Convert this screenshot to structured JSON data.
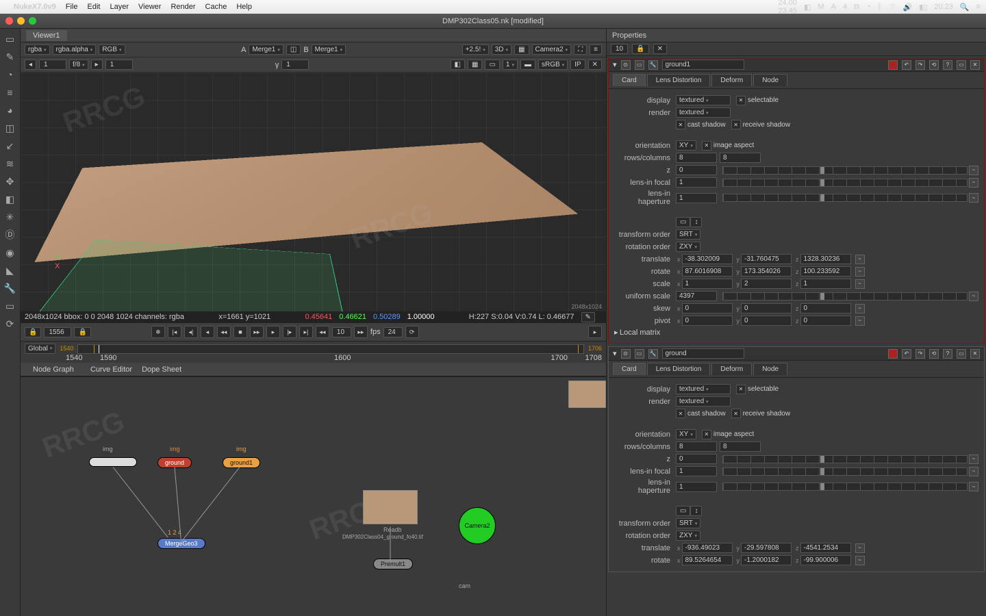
{
  "menubar": {
    "app": "NukeX7.0v9",
    "items": [
      "File",
      "Edit",
      "Layer",
      "Viewer",
      "Render",
      "Cache",
      "Help"
    ],
    "clock": "20:23",
    "fps_a": "24.00",
    "fps_b": "23.45",
    "tray_m": "M"
  },
  "window": {
    "title": "DMP302Class05.nk [modified]"
  },
  "viewer": {
    "tab": "Viewer1",
    "channels": [
      "rgba",
      "rgba.alpha",
      "RGB"
    ],
    "a_label": "A",
    "a_node": "Merge1",
    "b_label": "B",
    "b_node": "Merge1",
    "scale": "+2.5!",
    "mode3d": "3D",
    "camera": "Camera2",
    "fstop_pre": "1",
    "fstop": "f/8",
    "fstop_post": "1",
    "x": "1",
    "y": "1",
    "gamma": "1",
    "colorspace": "sRGB",
    "ip": "IP",
    "res_corner": "2048x1024",
    "status_bbox": "2048x1024 bbox: 0 0 2048 1024 channels: rgba",
    "status_xy": "x=1661 y=1021",
    "rgba": {
      "r": "0.45641",
      "g": "0.46621",
      "b": "0.50289",
      "a": "1.00000"
    },
    "hsvl": "H:227 S:0.04 V:0.74 L: 0.46677"
  },
  "transport": {
    "frame": "1556",
    "frame_start": "1540",
    "frame_end": "1706",
    "fps_label": "fps",
    "fps": "24",
    "spin": "10",
    "range": "Global",
    "ticks": [
      "1540",
      "1590",
      "1600",
      "1700",
      "1708"
    ]
  },
  "nodegraph": {
    "tabs": [
      "Node Graph",
      "Curve Editor",
      "Dope Sheet"
    ],
    "img": "img",
    "merge_label": "MergeGeo3",
    "ground": "ground",
    "ground1": "ground1",
    "readb": "Readb",
    "read_file": "DMP302Class04_ground_fo40.tif",
    "premult": "Premult1",
    "camera": "Camera2",
    "cam": "cam",
    "num": "1  2  4"
  },
  "props": {
    "title": "Properties",
    "count": "10",
    "panels": [
      {
        "name": "ground1",
        "tabs": [
          "Card",
          "Lens Distortion",
          "Deform",
          "Node"
        ],
        "display": "textured",
        "render": "textured",
        "selectable": "selectable",
        "cast": "cast shadow",
        "receive": "receive shadow",
        "orientation": "XY",
        "image_aspect": "image aspect",
        "rows": "8",
        "cols": "8",
        "z": "0",
        "focal": "1",
        "haperture": "1",
        "transform_order": "SRT",
        "rotation_order": "ZXY",
        "tx": "-38.302009",
        "ty": "-31.760475",
        "tz": "1328.30236",
        "rx": "87.6016908",
        "ry": "173.354026",
        "rz": "100.233592",
        "sx": "1",
        "sy": "2",
        "sz": "1",
        "uniform": "4397",
        "skx": "0",
        "sky": "0",
        "skz": "0",
        "px": "0",
        "py": "0",
        "pz": "0",
        "local_matrix": "Local matrix"
      },
      {
        "name": "ground",
        "tabs": [
          "Card",
          "Lens Distortion",
          "Deform",
          "Node"
        ],
        "display": "textured",
        "render": "textured",
        "selectable": "selectable",
        "cast": "cast shadow",
        "receive": "receive shadow",
        "orientation": "XY",
        "image_aspect": "image aspect",
        "rows": "8",
        "cols": "8",
        "z": "0",
        "focal": "1",
        "haperture": "1",
        "transform_order": "SRT",
        "rotation_order": "ZXY",
        "tx": "-936.49023",
        "ty": "-29.597808",
        "tz": "-4541.2534",
        "rx": "89.5264654",
        "ry": "-1.2000182",
        "rz": "-99.900006"
      }
    ],
    "labels": {
      "display": "display",
      "render": "render",
      "orientation": "orientation",
      "rowscols": "rows/columns",
      "z": "z",
      "focal": "lens-in focal",
      "hap": "lens-in haperture",
      "torder": "transform order",
      "rorder": "rotation order",
      "translate": "translate",
      "rotate": "rotate",
      "scale": "scale",
      "uniform": "uniform scale",
      "skew": "skew",
      "pivot": "pivot"
    }
  },
  "watermark": "RRCG"
}
